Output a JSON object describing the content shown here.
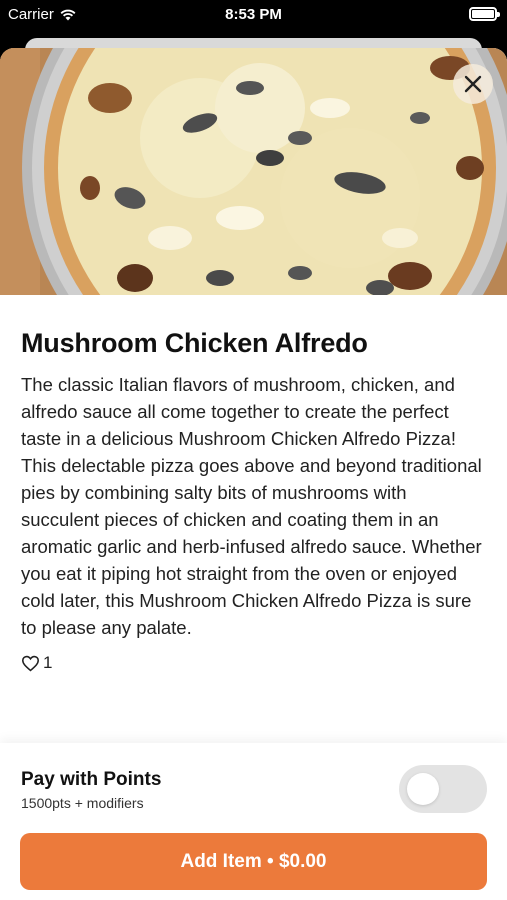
{
  "status_bar": {
    "carrier": "Carrier",
    "time": "8:53 PM"
  },
  "item": {
    "title": "Mushroom Chicken Alfredo",
    "description": "The classic Italian flavors of mushroom, chicken, and alfredo sauce all come together to create the perfect taste in a delicious Mushroom Chicken Alfredo Pizza! This delectable pizza goes above and beyond traditional pies by combining salty bits of mushrooms with succulent pieces of chicken and coating them in an aromatic garlic and herb-infused alfredo sauce. Whether you eat it piping hot straight from the oven or enjoyed cold later, this Mushroom Chicken Alfredo Pizza is sure to please any palate.",
    "likes": "1"
  },
  "points": {
    "title": "Pay with Points",
    "subtitle": "1500pts + modifiers",
    "enabled": false
  },
  "add_button_label": "Add Item • $0.00",
  "icons": {
    "close": "close-icon",
    "heart": "heart-icon",
    "wifi": "wifi-icon",
    "battery": "battery-icon"
  },
  "colors": {
    "accent": "#ec7a3b"
  }
}
